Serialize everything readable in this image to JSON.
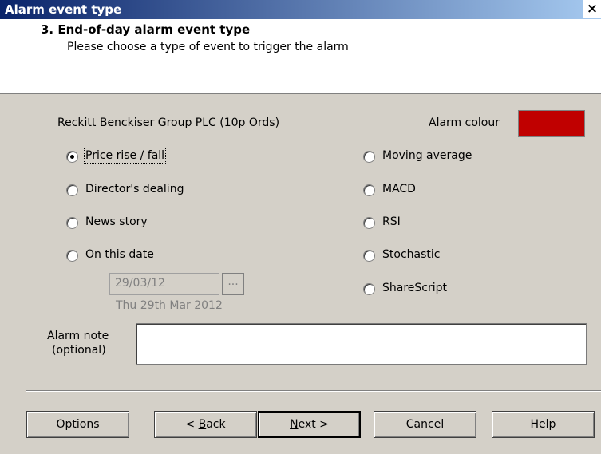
{
  "window": {
    "title": "Alarm event type",
    "close_glyph": "×"
  },
  "header": {
    "step_title": "3. End-of-day alarm event type",
    "step_description": "Please choose a type of event to trigger the alarm"
  },
  "security": {
    "name": "Reckitt Benckiser Group PLC (10p Ords)"
  },
  "alarm_colour": {
    "label": "Alarm colour",
    "value": "#c00000"
  },
  "event_types_left": [
    {
      "label": "Price rise / fall",
      "checked": true
    },
    {
      "label": "Director's dealing",
      "checked": false
    },
    {
      "label": "News story",
      "checked": false
    },
    {
      "label": "On this date",
      "checked": false
    }
  ],
  "event_types_right": [
    {
      "label": "Moving average",
      "checked": false
    },
    {
      "label": "MACD",
      "checked": false
    },
    {
      "label": "RSI",
      "checked": false
    },
    {
      "label": "Stochastic",
      "checked": false
    },
    {
      "label": "ShareScript",
      "checked": false
    }
  ],
  "date": {
    "value": "29/03/12",
    "picker_label": "...",
    "readout": "Thu 29th Mar 2012"
  },
  "note": {
    "label_line1": "Alarm note",
    "label_line2": "(optional)",
    "value": ""
  },
  "buttons": {
    "options": "Options",
    "back_prefix": "< ",
    "back_mnemonic": "B",
    "back_rest": "ack",
    "next_mnemonic": "N",
    "next_rest": "ext >",
    "cancel": "Cancel",
    "help": "Help"
  }
}
